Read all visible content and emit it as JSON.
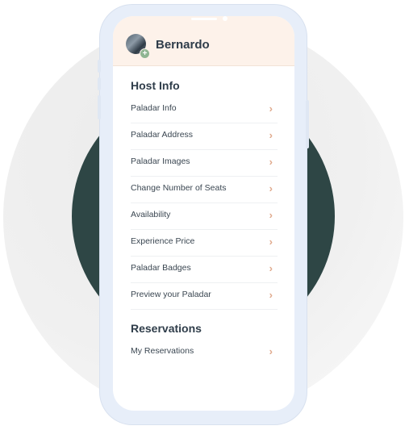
{
  "user": {
    "name": "Bernardo",
    "avatar_badge": "+"
  },
  "host_info": {
    "title": "Host Info",
    "items": [
      {
        "label": "Paladar Info",
        "icon": "chevron-right-icon"
      },
      {
        "label": "Paladar Address",
        "icon": "chevron-right-icon"
      },
      {
        "label": "Paladar Images",
        "icon": "chevron-right-icon"
      },
      {
        "label": "Change Number of Seats",
        "icon": "chevron-right-icon"
      },
      {
        "label": "Availability",
        "icon": "chevron-right-icon"
      },
      {
        "label": "Experience Price",
        "icon": "chevron-right-icon"
      },
      {
        "label": "Paladar Badges",
        "icon": "chevron-right-icon"
      },
      {
        "label": "Preview your Paladar",
        "icon": "chevron-right-icon"
      }
    ]
  },
  "reservations": {
    "title": "Reservations",
    "items": [
      {
        "label": "My Reservations",
        "icon": "chevron-right-icon"
      }
    ]
  },
  "colors": {
    "header_bg": "#fdf2ea",
    "chevron": "#e0a98c",
    "dark_circle": "#2e4645",
    "phone_frame": "#e7eef9",
    "text": "#2f3d4a"
  },
  "chevron_glyph": "›"
}
